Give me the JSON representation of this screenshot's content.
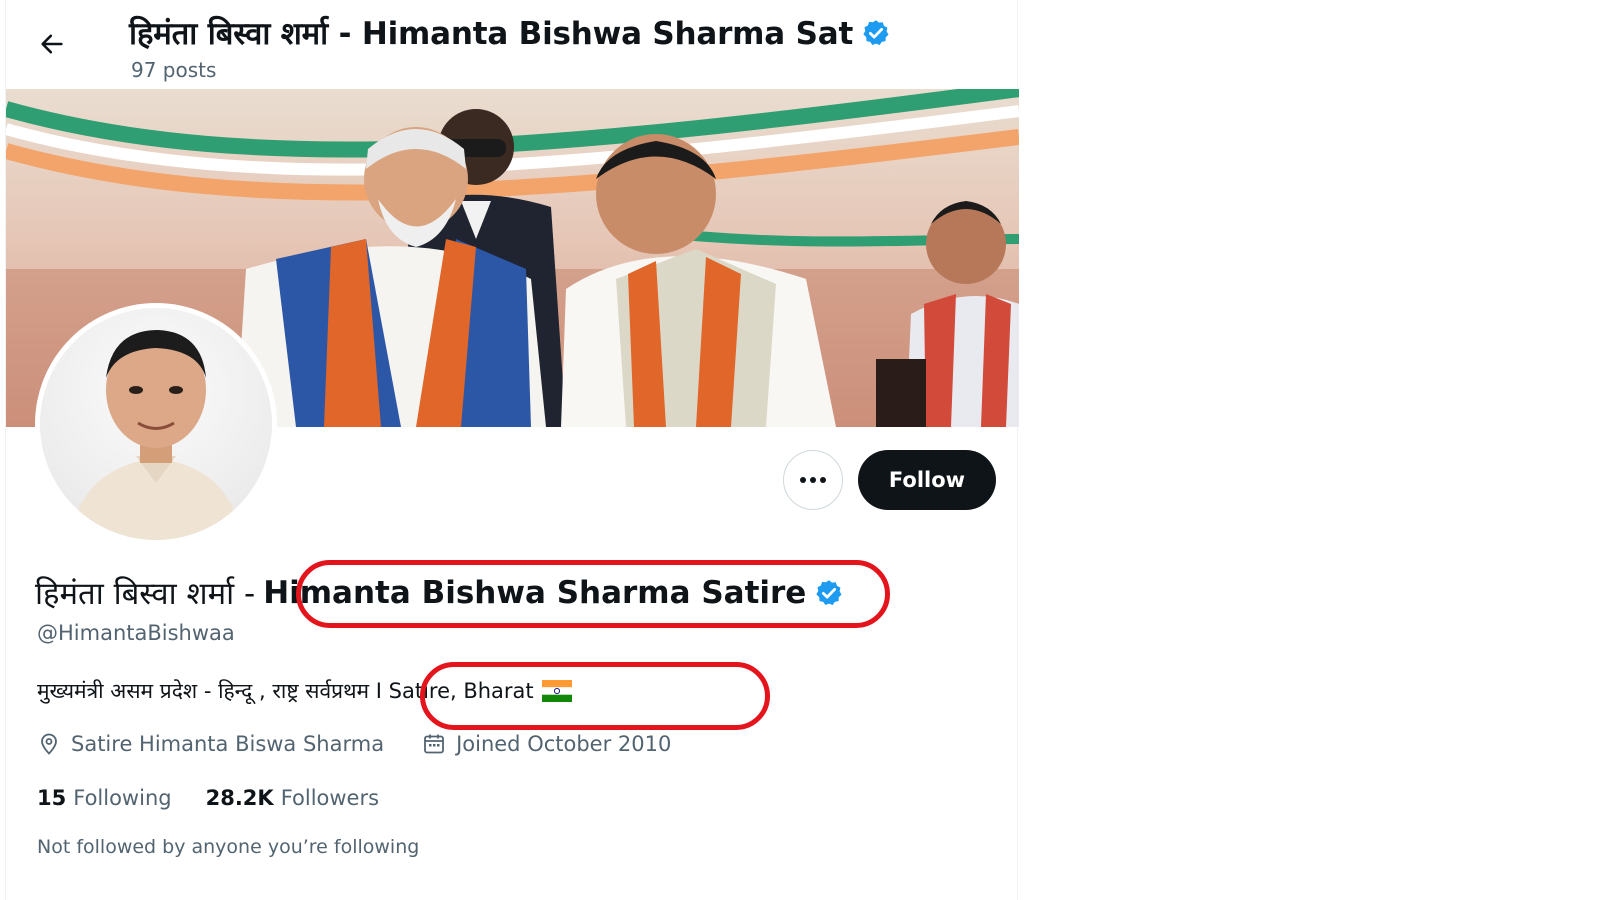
{
  "header": {
    "back_icon": "arrow-left-icon",
    "title": "हिमंता बिस्वा शर्मा - Himanta Bishwa Sharma Sat",
    "post_count": "97 posts",
    "verified_icon": "verified-badge-icon"
  },
  "banner": {
    "image": "rally-stage-photo",
    "stripe_colors": [
      "#2f9e73",
      "#f3a46a",
      "#ffffff"
    ]
  },
  "avatar": {
    "image": "profile-portrait"
  },
  "actions": {
    "more_icon": "more-horizontal-icon",
    "follow_label": "Follow"
  },
  "profile": {
    "name_devanagari": "हिमंता बिस्वा शर्मा -",
    "name_english": "Himanta Bishwa Sharma Satire",
    "handle": "@HimantaBishwaa",
    "bio_text": "मुख्यमंत्री असम प्रदेश - हिन्दू , राष्ट्र सर्वप्रथम I Satire, Bharat",
    "bio_flag_icon": "india-flag-icon",
    "location_icon": "location-pin-icon",
    "location": "Satire Himanta Biswa Sharma",
    "calendar_icon": "calendar-icon",
    "joined": "Joined October 2010"
  },
  "stats": {
    "following_count": "15",
    "following_label": "Following",
    "followers_count": "28.2K",
    "followers_label": "Followers"
  },
  "followed_by": "Not followed by anyone you’re following",
  "colors": {
    "text_primary": "#0f1419",
    "text_secondary": "#536471",
    "verified_blue": "#1d9bf0",
    "annotation_red": "#e3141b",
    "follow_button_bg": "#0f1419"
  }
}
